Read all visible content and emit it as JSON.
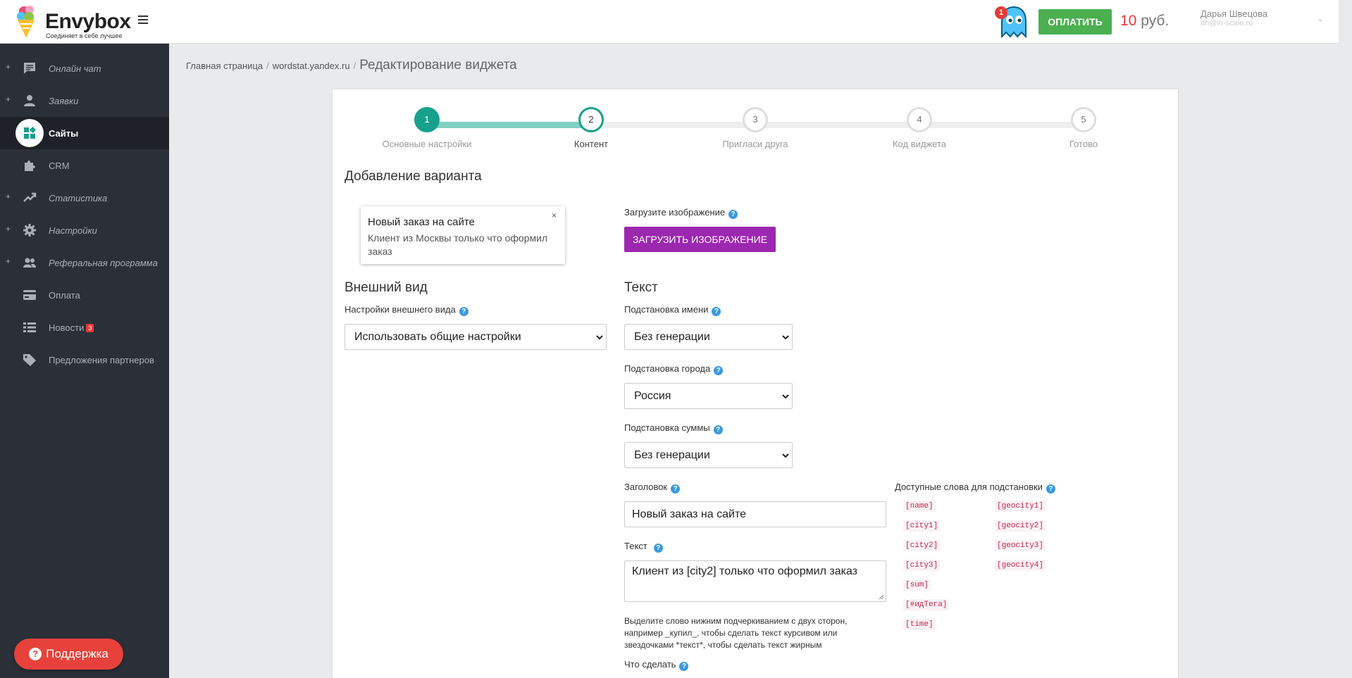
{
  "header": {
    "logo_name": "Envybox",
    "logo_slogan": "Соединяет в себе лучшее",
    "notifications_count": "1",
    "pay_label": "ОПЛАТИТЬ",
    "balance_amount": "10",
    "balance_currency": "руб.",
    "user_name": "Дарья Швецова",
    "user_email": "dh@in-scale.ru"
  },
  "sidebar": {
    "items": [
      {
        "label": "Онлайн чат",
        "icon": "chat-icon",
        "expandable": true
      },
      {
        "label": "Заявки",
        "icon": "person-icon",
        "expandable": true
      },
      {
        "label": "Сайты",
        "icon": "sites-icon",
        "active": true
      },
      {
        "label": "CRM",
        "icon": "puzzle-icon"
      },
      {
        "label": "Статистика",
        "icon": "trending-icon",
        "expandable": true
      },
      {
        "label": "Настройки",
        "icon": "gear-icon",
        "expandable": true
      },
      {
        "label": "Реферальная программа",
        "icon": "people-icon",
        "expandable": true
      },
      {
        "label": "Оплата",
        "icon": "card-icon"
      },
      {
        "label": "Новости",
        "icon": "list-icon",
        "badge": "3"
      },
      {
        "label": "Предложения партнеров",
        "icon": "tag-icon"
      }
    ],
    "expand_symbol": "+",
    "support_label": "Поддержка",
    "support_icon_text": "?"
  },
  "breadcrumb": {
    "home": "Главная страница",
    "site": "wordstat.yandex.ru",
    "current": "Редактирование виджета",
    "separator": "/"
  },
  "stepper": {
    "steps": [
      {
        "number": "1",
        "label": "Основные настройки",
        "state": "done"
      },
      {
        "number": "2",
        "label": "Контент",
        "state": "current"
      },
      {
        "number": "3",
        "label": "Пригласи друга",
        "state": "pending"
      },
      {
        "number": "4",
        "label": "Код виджета",
        "state": "pending"
      },
      {
        "number": "5",
        "label": "Готово",
        "state": "pending"
      }
    ]
  },
  "form": {
    "heading": "Добавление варианта",
    "preview": {
      "title": "Новый заказ на сайте",
      "text": "Клиент из Москвы только что оформил заказ",
      "close_symbol": "×"
    },
    "upload_label": "Загрузите изображение",
    "upload_button": "ЗАГРУЗИТЬ ИЗОБРАЖЕНИЕ",
    "appearance_heading": "Внешний вид",
    "appearance_label": "Настройки внешнего вида",
    "appearance_value": "Использовать общие настройки",
    "text_heading": "Текст",
    "name_label": "Подстановка имени",
    "name_value": "Без генерации",
    "city_label": "Подстановка города",
    "city_value": "Россия",
    "sum_label": "Подстановка суммы",
    "sum_value": "Без генерации",
    "title_label": "Заголовок",
    "title_value": "Новый заказ на сайте",
    "body_label": "Текст",
    "body_value": "Клиент из [city2] только что оформил заказ",
    "hint": "Выделите слово нижним подчеркиванием с двух сторон, например _купил_, чтобы сделать текст курсивом или звездочками *текст*, чтобы сделать текст жирным",
    "action_label": "Что сделать",
    "help_symbol": "?"
  },
  "placeholders": {
    "heading": "Доступные слова для подстановки",
    "left": [
      "[name]",
      "[city1]",
      "[city2]",
      "[city3]",
      "[sum]",
      "[#идТега]",
      "[time]"
    ],
    "right": [
      "[geocity1]",
      "[geocity2]",
      "[geocity3]",
      "[geocity4]"
    ]
  },
  "colors": {
    "sidebar_bg": "#2b3038",
    "accent_teal": "#17a08c",
    "pay_green": "#4caf50",
    "upload_purple": "#9c27b0",
    "support_red": "#e8413b",
    "help_blue": "#3a9ae0"
  }
}
